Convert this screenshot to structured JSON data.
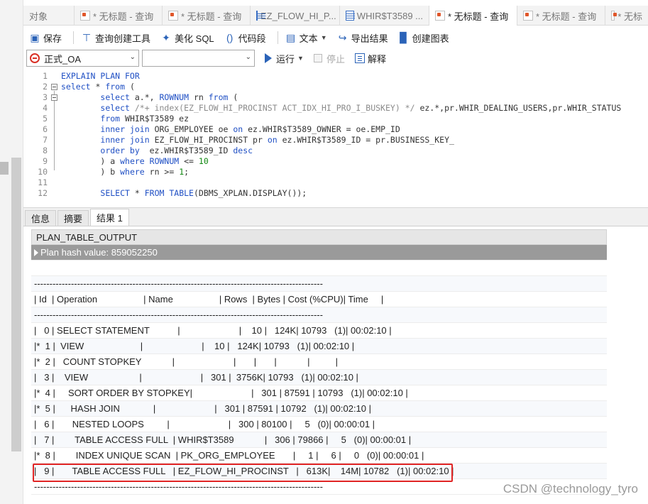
{
  "tabs": [
    {
      "label": "对象",
      "icon": "none",
      "active": false
    },
    {
      "label": "* 无标题 - 查询",
      "icon": "query-icon",
      "active": false
    },
    {
      "label": "* 无标题 - 查询",
      "icon": "query-icon",
      "active": false
    },
    {
      "label": "EZ_FLOW_HI_P...",
      "icon": "table-icon",
      "active": false
    },
    {
      "label": "WHIR$T3589 ...",
      "icon": "table-icon",
      "active": false
    },
    {
      "label": "* 无标题 - 查询",
      "icon": "query-icon",
      "active": true
    },
    {
      "label": "* 无标题 - 查询",
      "icon": "query-icon",
      "active": false
    },
    {
      "label": "* 无标",
      "icon": "query-icon",
      "active": false
    }
  ],
  "toolbar": {
    "save": "保存",
    "query_builder": "查询创建工具",
    "beautify": "美化 SQL",
    "snippet": "代码段",
    "text": "文本",
    "export": "导出结果",
    "create_chart": "创建图表"
  },
  "connection": {
    "selected": "正式_OA",
    "schema": "",
    "run": "运行",
    "stop": "停止",
    "explain": "解释"
  },
  "editor": {
    "lines": [
      {
        "n": "1",
        "text": "EXPLAIN PLAN FOR"
      },
      {
        "n": "2",
        "text": "select * from ("
      },
      {
        "n": "3",
        "text": "        select a.*, ROWNUM rn from ("
      },
      {
        "n": "4",
        "text": "        select /*+ index(EZ_FLOW_HI_PROCINST ACT_IDX_HI_PRO_I_BUSKEY) */ ez.*,pr.WHIR_DEALING_USERS,pr.WHIR_STATUS"
      },
      {
        "n": "5",
        "text": "        from WHIR$T3589 ez"
      },
      {
        "n": "6",
        "text": "        inner join ORG_EMPLOYEE oe on ez.WHIR$T3589_OWNER = oe.EMP_ID"
      },
      {
        "n": "7",
        "text": "        inner join EZ_FLOW_HI_PROCINST pr on ez.WHIR$T3589_ID = pr.BUSINESS_KEY_"
      },
      {
        "n": "8",
        "text": "        order by  ez.WHIR$T3589_ID desc"
      },
      {
        "n": "9",
        "text": "        ) a where ROWNUM <= 10"
      },
      {
        "n": "10",
        "text": "        ) b where rn >= 1;"
      },
      {
        "n": "11",
        "text": ""
      },
      {
        "n": "12",
        "text": "        SELECT * FROM TABLE(DBMS_XPLAN.DISPLAY());"
      }
    ]
  },
  "result_tabs": [
    "信息",
    "摘要",
    "结果 1"
  ],
  "grid": {
    "column": "PLAN_TABLE_OUTPUT",
    "rows": [
      "Plan hash value: 859052250",
      "",
      "----------------------------------------------------------------------------------------------",
      "| Id  | Operation                  | Name                  | Rows  | Bytes | Cost (%CPU)| Time     |",
      "----------------------------------------------------------------------------------------------",
      "|   0 | SELECT STATEMENT           |                       |    10 |   124K| 10793   (1)| 00:02:10 |",
      "|*  1 |  VIEW                      |                       |    10 |   124K| 10793   (1)| 00:02:10 |",
      "|*  2 |   COUNT STOPKEY            |                       |       |       |            |          |",
      "|   3 |    VIEW                    |                       |   301 |  3756K| 10793   (1)| 00:02:10 |",
      "|*  4 |     SORT ORDER BY STOPKEY|                       |   301 | 87591 | 10793   (1)| 00:02:10 |",
      "|*  5 |      HASH JOIN             |                       |   301 | 87591 | 10792   (1)| 00:02:10 |",
      "|   6 |       NESTED LOOPS         |                       |   300 | 80100 |     5   (0)| 00:00:01 |",
      "|   7 |        TABLE ACCESS FULL  | WHIR$T3589            |   306 | 79866 |     5   (0)| 00:00:01 |",
      "|*  8 |        INDEX UNIQUE SCAN  | PK_ORG_EMPLOYEE       |     1 |     6 |     0   (0)| 00:00:01 |",
      "|   9 |       TABLE ACCESS FULL   | EZ_FLOW_HI_PROCINST   |   613K|    14M| 10782   (1)| 00:02:10 |",
      "----------------------------------------------------------------------------------------------"
    ]
  },
  "watermark": "CSDN @technology_tyro",
  "colors": {
    "keyword": "#1f4fc4",
    "comment": "#8b8b8b",
    "number": "#118811",
    "highlight_box": "#e02424",
    "selected_row": "#9a9a9a"
  }
}
